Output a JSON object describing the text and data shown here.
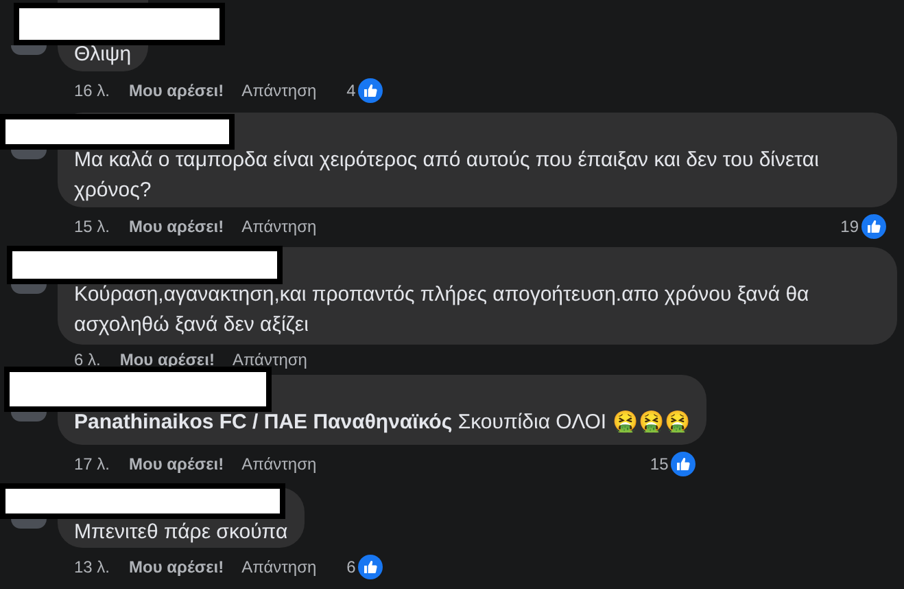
{
  "comments": [
    {
      "text": "Θλιψη",
      "time": "16 λ.",
      "like": "Μου αρέσει!",
      "reply": "Απάντηση",
      "reactions": "4"
    },
    {
      "text": "Μα καλά ο ταμπορδα είναι χειρότερος από αυτούς που έπαιξαν και δεν του δίνεται χρόνος?",
      "time": "15 λ.",
      "like": "Μου αρέσει!",
      "reply": "Απάντηση",
      "reactions": "19"
    },
    {
      "text": "Κούραση,αγανακτηση,και προπαντός πλήρες απογοήτευση.απο χρόνου ξανά θα ασχοληθώ ξανά δεν αξίζει",
      "time": "6 λ.",
      "like": "Μου αρέσει!",
      "reply": "Απάντηση"
    },
    {
      "tag": "Panathinaikos FC / ΠΑΕ Παναθηναϊκός",
      "text": "Σκουπίδια ΟΛΟΙ 🤮🤮🤮",
      "time": "17 λ.",
      "like": "Μου αρέσει!",
      "reply": "Απάντηση",
      "reactions": "15"
    },
    {
      "text": "Μπενιτεθ πάρε σκούπα",
      "time": "13 λ.",
      "like": "Μου αρέσει!",
      "reply": "Απάντηση",
      "reactions": "6"
    }
  ]
}
